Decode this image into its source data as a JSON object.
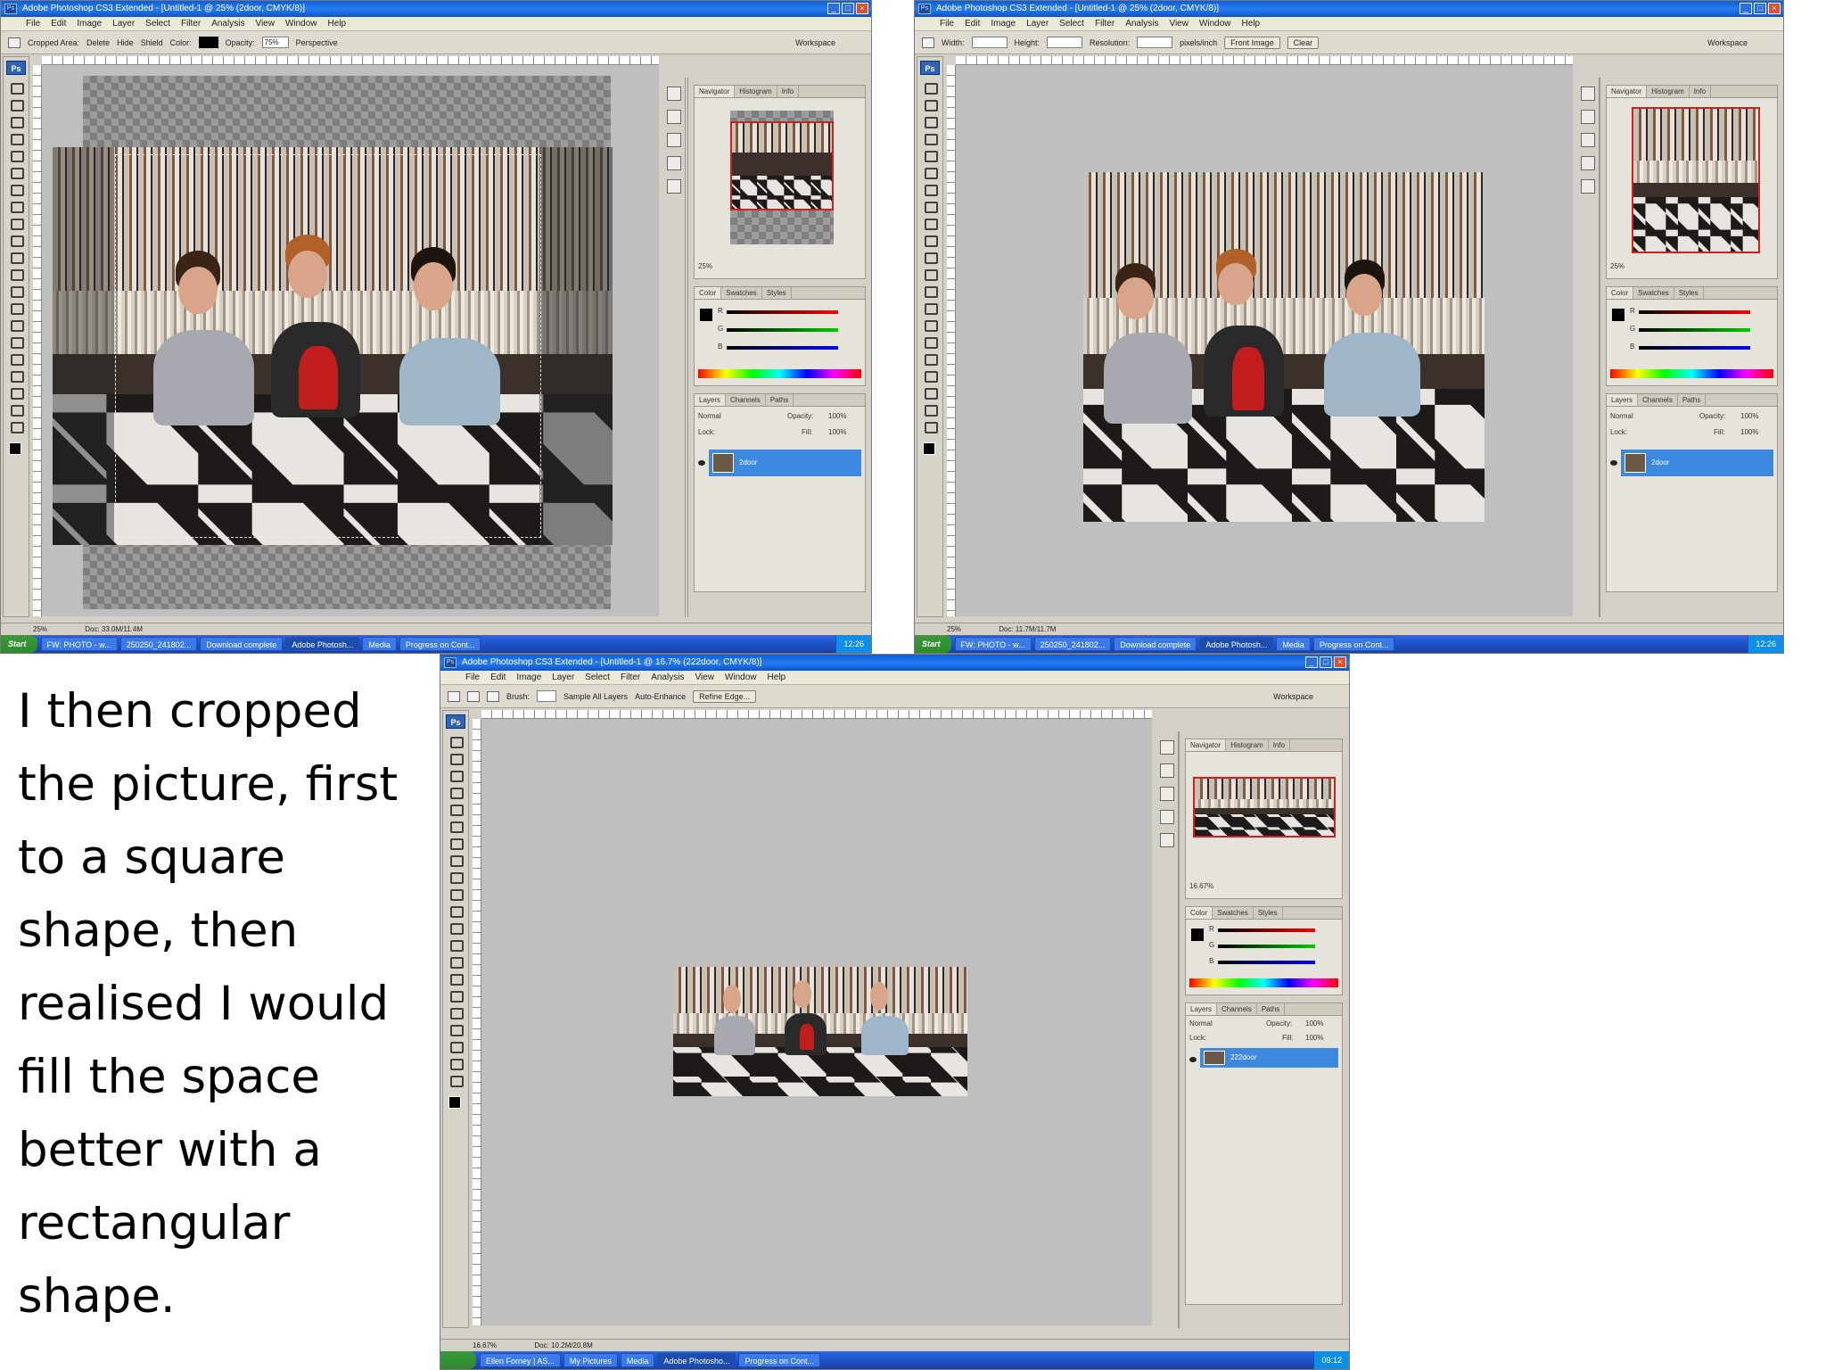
{
  "shots": [
    {
      "title": "Adobe Photoshop CS3 Extended - [Untitled-1 @ 25% (2door, CMYK/8)]",
      "options": {
        "cropped_area_label": "Cropped Area:",
        "delete_label": "Delete",
        "hide_label": "Hide",
        "shield_label": "Shield",
        "color_label": "Color:",
        "opacity_label": "Opacity:",
        "opacity_value": "75%",
        "perspective_label": "Perspective",
        "workspace_label": "Workspace"
      },
      "zoom": "25%",
      "doc": "Doc: 33.0M/11.4M",
      "layer_name": "2door"
    },
    {
      "title": "Adobe Photoshop CS3 Extended - [Untitled-1 @ 25% (2door, CMYK/8)]",
      "options": {
        "width_label": "Width:",
        "height_label": "Height:",
        "resolution_label": "Resolution:",
        "units": "pixels/inch",
        "front_image": "Front Image",
        "clear": "Clear",
        "workspace_label": "Workspace"
      },
      "zoom": "25%",
      "doc": "Doc: 11.7M/11.7M",
      "layer_name": "2door"
    },
    {
      "title": "Adobe Photoshop CS3 Extended - [Untitled-1 @ 16.7% (222door, CMYK/8)]",
      "options": {
        "brush_label": "Brush:",
        "sample_all": "Sample All Layers",
        "auto_enhance": "Auto-Enhance",
        "refine_edge": "Refine Edge...",
        "workspace_label": "Workspace"
      },
      "zoom": "16.67%",
      "nav_zoom": "16.67%",
      "doc": "Doc: 10.2M/20.8M",
      "layer_name": "222door"
    }
  ],
  "menu": [
    "File",
    "Edit",
    "Image",
    "Layer",
    "Select",
    "Filter",
    "Analysis",
    "View",
    "Window",
    "Help"
  ],
  "panel_tabs": {
    "nav": [
      "Navigator",
      "Histogram",
      "Info"
    ],
    "color": [
      "Color",
      "Swatches",
      "Styles"
    ],
    "layers": [
      "Layers",
      "Channels",
      "Paths"
    ]
  },
  "layers_panel": {
    "blend_mode": "Normal",
    "opacity_label": "Opacity:",
    "opacity_value": "100%",
    "lock_label": "Lock:",
    "fill_label": "Fill:",
    "fill_value": "100%"
  },
  "color_panel": {
    "r": "R",
    "g": "G",
    "b": "B"
  },
  "taskbars": [
    {
      "start": "Start",
      "tasks": [
        "FW: PHOTO - w...",
        "250250_241802...",
        "Download complete",
        "Adobe Photosh...",
        "Media",
        "Progress on Cont..."
      ],
      "clock": "12:26"
    },
    {
      "start": "Start",
      "tasks": [
        "FW: PHOTO - w...",
        "250250_241802...",
        "Download complete",
        "Adobe Photosh...",
        "Media",
        "Progress on Cont..."
      ],
      "clock": "12:26"
    },
    {
      "start": "",
      "tasks": [
        "Ellen Forney | AS...",
        "My Pictures",
        "Media",
        "Adobe Photosho...",
        "Progress on Cont..."
      ],
      "clock": "09:12"
    }
  ],
  "caption_lines": [
    "I then cropped",
    "the picture, first",
    "to a square",
    "shape, then",
    "realised I would",
    "fill the space",
    "better with a",
    "rectangular",
    "shape."
  ],
  "colors": {
    "titlebar": "#0a5ed8",
    "selected_layer": "#3e89e0",
    "canvas_bg": "#bfbfbf",
    "nav_frame": "#d02020"
  }
}
